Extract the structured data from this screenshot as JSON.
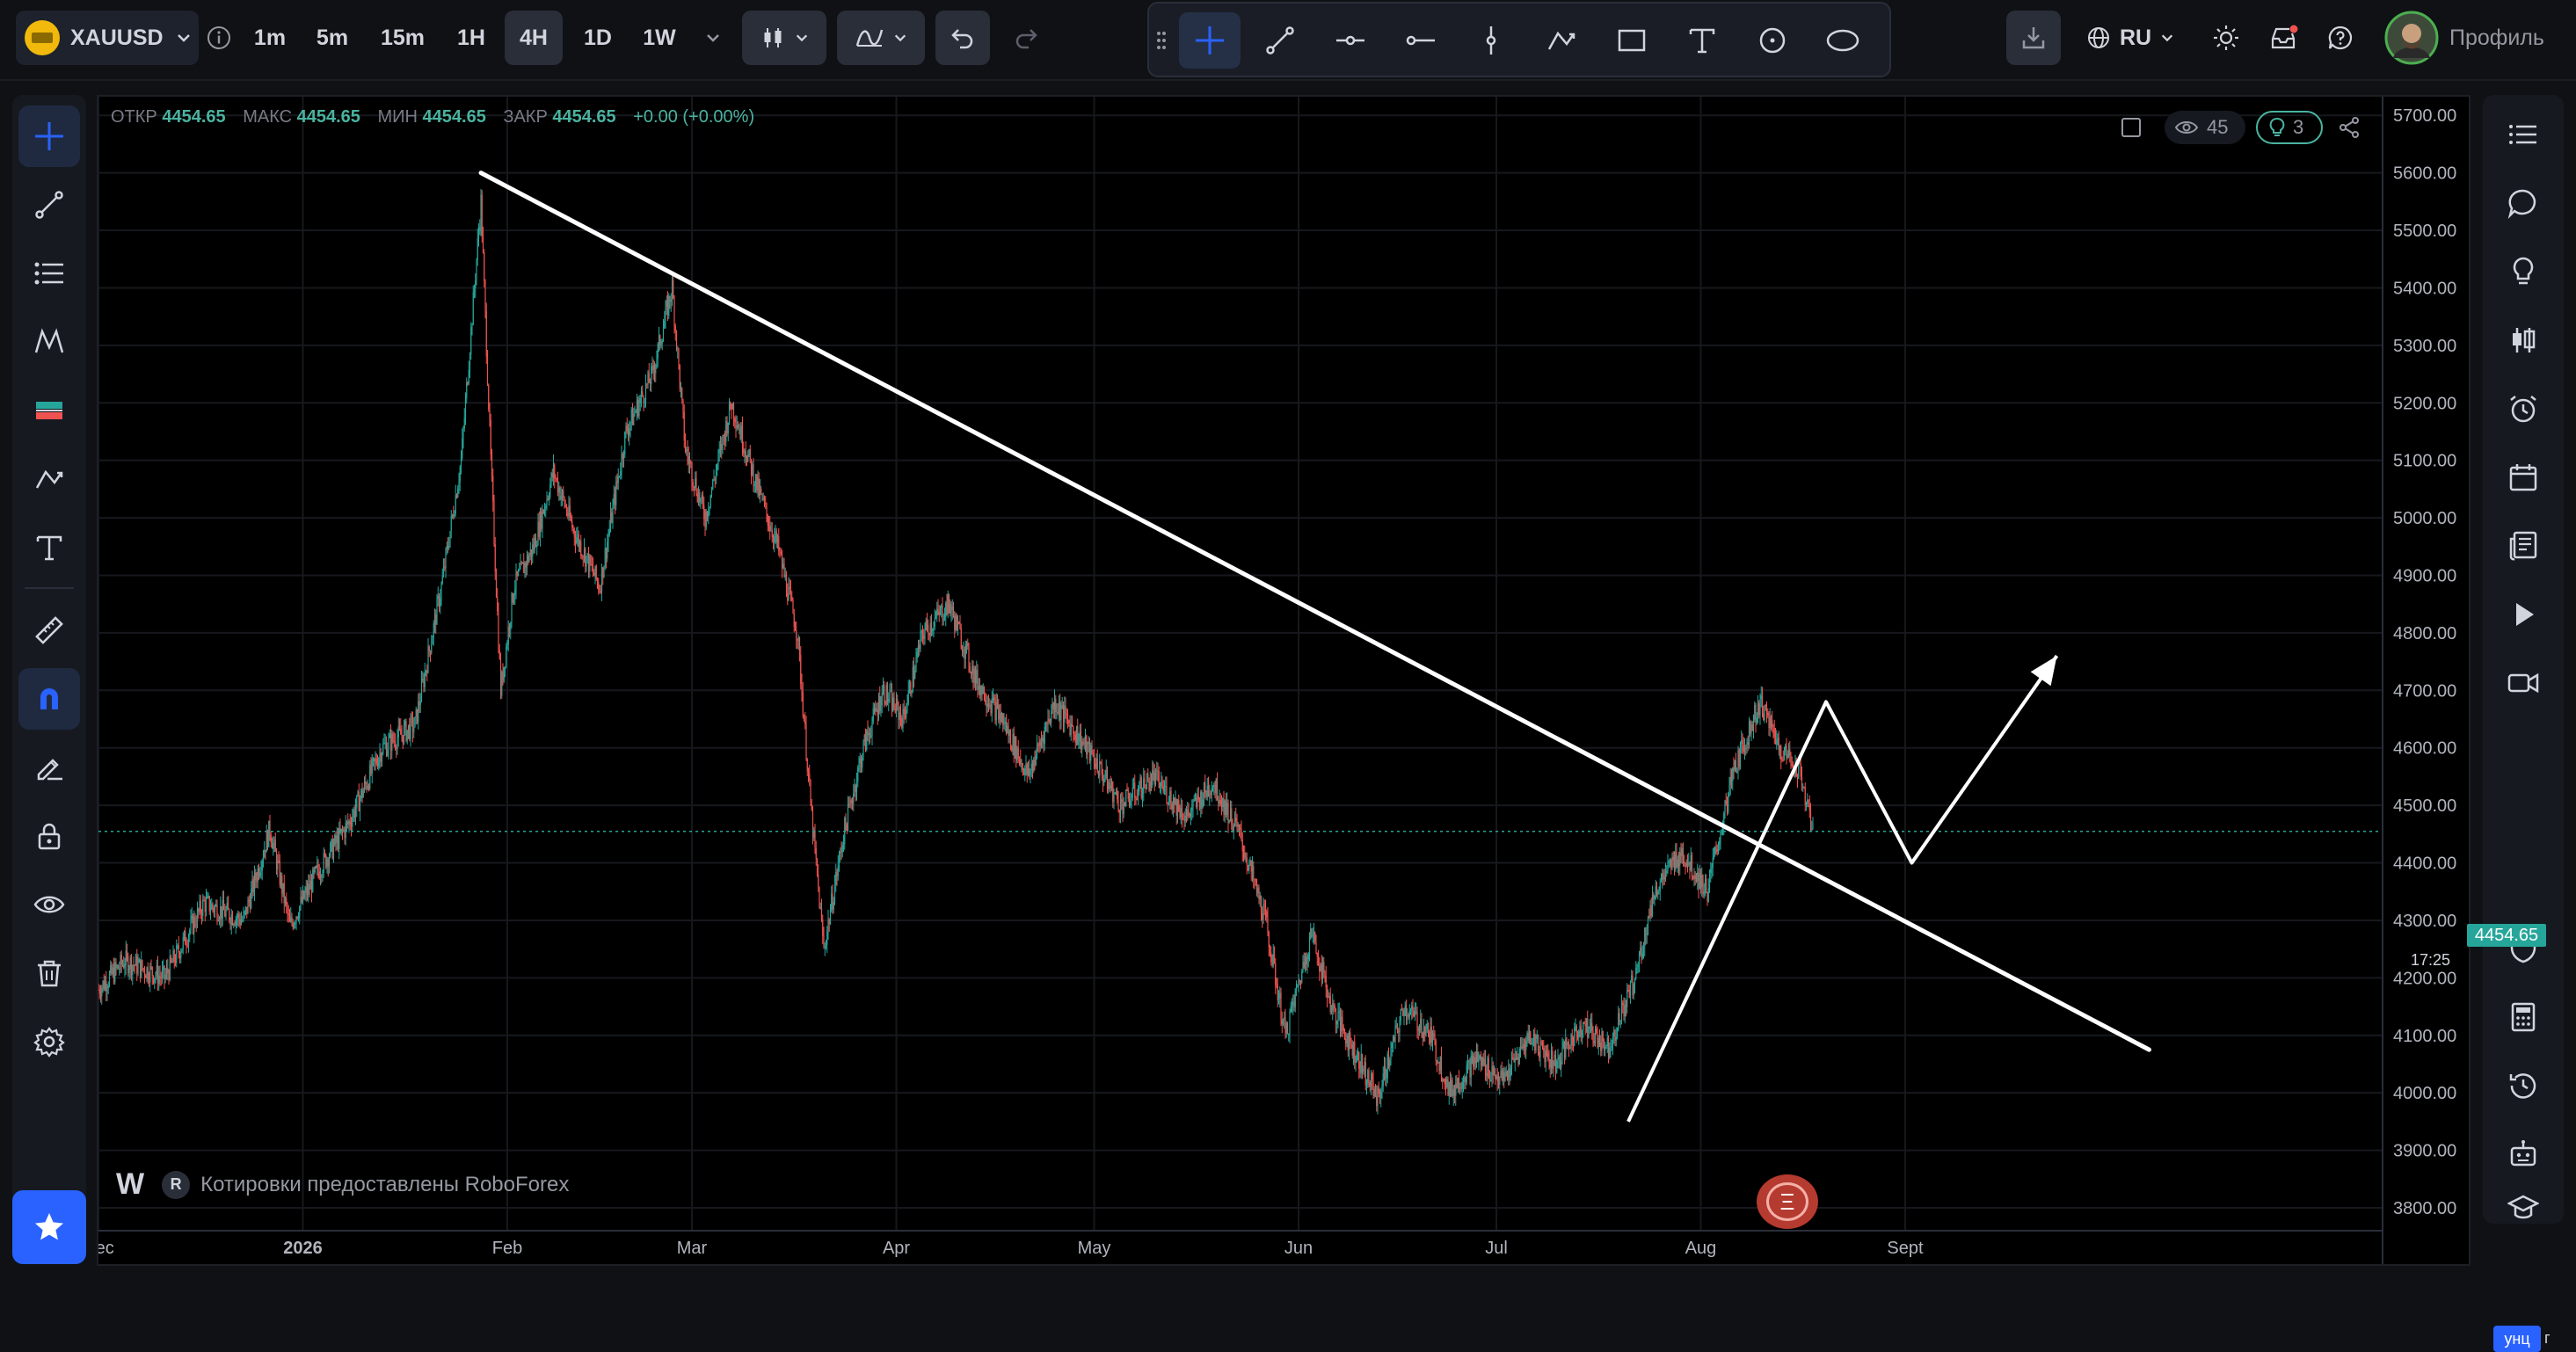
{
  "symbol": {
    "name": "XAUUSD"
  },
  "timeframes": [
    {
      "label": "1m",
      "active": false
    },
    {
      "label": "5m",
      "active": false
    },
    {
      "label": "15m",
      "active": false
    },
    {
      "label": "1H",
      "active": false
    },
    {
      "label": "4H",
      "active": true
    },
    {
      "label": "1D",
      "active": false
    },
    {
      "label": "1W",
      "active": false
    }
  ],
  "header": {
    "language": "RU",
    "profile_label": "Профиль"
  },
  "ohlc": {
    "open_label": "ОТКР",
    "open": "4454.65",
    "high_label": "МАКС",
    "high": "4454.65",
    "low_label": "МИН",
    "low": "4454.65",
    "close_label": "ЗАКР",
    "close": "4454.65",
    "change": "+0.00 (+0.00%)"
  },
  "overlay": {
    "viewers": "45",
    "ideas": "3"
  },
  "watermark": {
    "logo": "W",
    "r_badge": "R",
    "text": "Котировки предоставлены RoboForex"
  },
  "event_badge": {
    "symbol": "Ξ"
  },
  "current_price_badge": "4454.65",
  "countdown": "17:25",
  "timezone_badge": "унц",
  "timezone_extra": "г",
  "colors": {
    "up": "#26a69a",
    "down": "#ef5350",
    "accent": "#2962ff",
    "background": "#000000",
    "drawing": "#ffffff"
  },
  "chart_data": {
    "type": "candlestick",
    "timeframe": "4H",
    "y_axis_labels": [
      "5700.00",
      "5600.00",
      "5500.00",
      "5400.00",
      "5300.00",
      "5200.00",
      "5100.00",
      "5000.00",
      "4900.00",
      "4800.00",
      "4700.00",
      "4600.00",
      "4500.00",
      "4400.00",
      "4300.00",
      "4200.00",
      "4100.00",
      "4000.00",
      "3900.00",
      "3800.00"
    ],
    "ylim": [
      3770,
      5740
    ],
    "x_axis_labels": [
      {
        "label": "Dec",
        "day": 0
      },
      {
        "label": "2026",
        "day": 31
      },
      {
        "label": "Feb",
        "day": 62
      },
      {
        "label": "Mar",
        "day": 90
      },
      {
        "label": "Apr",
        "day": 121
      },
      {
        "label": "May",
        "day": 151
      },
      {
        "label": "Jun",
        "day": 182
      },
      {
        "label": "Jul",
        "day": 212
      },
      {
        "label": "Aug",
        "day": 243
      },
      {
        "label": "Sept",
        "day": 274
      }
    ],
    "price_series": [
      {
        "day": 0,
        "price": 4180
      },
      {
        "day": 4,
        "price": 4230
      },
      {
        "day": 10,
        "price": 4200
      },
      {
        "day": 16,
        "price": 4330
      },
      {
        "day": 22,
        "price": 4300
      },
      {
        "day": 26,
        "price": 4460
      },
      {
        "day": 29,
        "price": 4290
      },
      {
        "day": 33,
        "price": 4380
      },
      {
        "day": 38,
        "price": 4470
      },
      {
        "day": 43,
        "price": 4600
      },
      {
        "day": 48,
        "price": 4640
      },
      {
        "day": 52,
        "price": 4880
      },
      {
        "day": 55,
        "price": 5100
      },
      {
        "day": 57,
        "price": 5400
      },
      {
        "day": 58,
        "price": 5550
      },
      {
        "day": 59.5,
        "price": 5100
      },
      {
        "day": 61,
        "price": 4700
      },
      {
        "day": 63,
        "price": 4880
      },
      {
        "day": 66,
        "price": 4950
      },
      {
        "day": 69,
        "price": 5080
      },
      {
        "day": 72,
        "price": 4980
      },
      {
        "day": 76,
        "price": 4880
      },
      {
        "day": 80,
        "price": 5150
      },
      {
        "day": 84,
        "price": 5250
      },
      {
        "day": 87,
        "price": 5400
      },
      {
        "day": 89,
        "price": 5120
      },
      {
        "day": 92,
        "price": 5000
      },
      {
        "day": 96,
        "price": 5200
      },
      {
        "day": 100,
        "price": 5050
      },
      {
        "day": 103,
        "price": 4950
      },
      {
        "day": 106,
        "price": 4800
      },
      {
        "day": 108,
        "price": 4500
      },
      {
        "day": 110,
        "price": 4250
      },
      {
        "day": 113,
        "price": 4450
      },
      {
        "day": 116,
        "price": 4600
      },
      {
        "day": 119,
        "price": 4700
      },
      {
        "day": 122,
        "price": 4650
      },
      {
        "day": 125,
        "price": 4800
      },
      {
        "day": 129,
        "price": 4850
      },
      {
        "day": 133,
        "price": 4720
      },
      {
        "day": 137,
        "price": 4650
      },
      {
        "day": 141,
        "price": 4550
      },
      {
        "day": 145,
        "price": 4680
      },
      {
        "day": 148,
        "price": 4630
      },
      {
        "day": 151,
        "price": 4580
      },
      {
        "day": 155,
        "price": 4500
      },
      {
        "day": 160,
        "price": 4550
      },
      {
        "day": 165,
        "price": 4480
      },
      {
        "day": 169,
        "price": 4540
      },
      {
        "day": 173,
        "price": 4450
      },
      {
        "day": 177,
        "price": 4300
      },
      {
        "day": 180,
        "price": 4100
      },
      {
        "day": 184,
        "price": 4280
      },
      {
        "day": 187,
        "price": 4150
      },
      {
        "day": 191,
        "price": 4060
      },
      {
        "day": 194,
        "price": 3990
      },
      {
        "day": 198,
        "price": 4150
      },
      {
        "day": 202,
        "price": 4100
      },
      {
        "day": 205,
        "price": 4000
      },
      {
        "day": 209,
        "price": 4060
      },
      {
        "day": 213,
        "price": 4020
      },
      {
        "day": 217,
        "price": 4100
      },
      {
        "day": 221,
        "price": 4050
      },
      {
        "day": 225,
        "price": 4120
      },
      {
        "day": 229,
        "price": 4080
      },
      {
        "day": 233,
        "price": 4200
      },
      {
        "day": 236,
        "price": 4350
      },
      {
        "day": 240,
        "price": 4420
      },
      {
        "day": 244,
        "price": 4350
      },
      {
        "day": 248,
        "price": 4560
      },
      {
        "day": 252,
        "price": 4680
      },
      {
        "day": 255,
        "price": 4600
      },
      {
        "day": 258,
        "price": 4560
      },
      {
        "day": 260,
        "price": 4455
      }
    ],
    "current_price": 4454.65,
    "drawings": [
      {
        "kind": "trend-line",
        "points": [
          {
            "day": 58,
            "price": 5600
          },
          {
            "day": 311,
            "price": 4075
          }
        ]
      },
      {
        "kind": "polyline",
        "points": [
          {
            "day": 232,
            "price": 3950
          },
          {
            "day": 262,
            "price": 4680
          },
          {
            "day": 275,
            "price": 4400
          },
          {
            "day": 297,
            "price": 4760
          }
        ],
        "arrow_end": true
      }
    ]
  }
}
